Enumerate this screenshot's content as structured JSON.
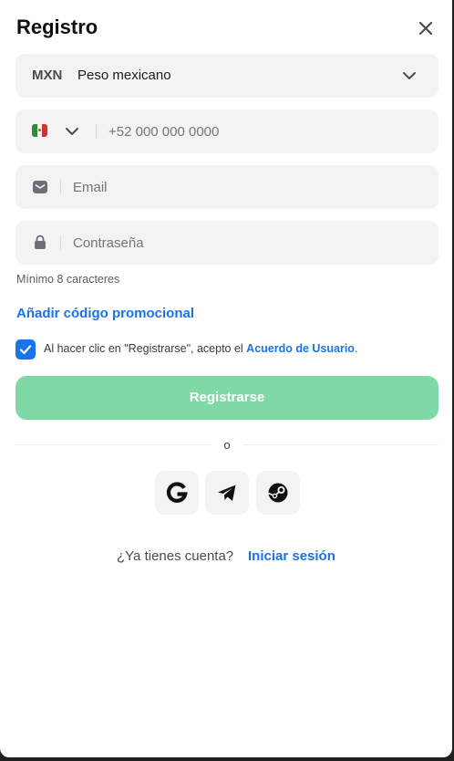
{
  "title": "Registro",
  "currency": {
    "code": "MXN",
    "name": "Peso mexicano"
  },
  "phone": {
    "placeholder": "+52 000 000 0000",
    "flag": "mexico-flag-icon"
  },
  "email": {
    "placeholder": "Email",
    "icon": "mail-icon"
  },
  "password": {
    "placeholder": "Contraseña",
    "icon": "lock-icon",
    "hint": "Mínimo 8 caracteres"
  },
  "promo_link": "Añadir código promocional",
  "terms": {
    "checked": true,
    "text": "Al hacer clic en \"Registrarse\", acepto el ",
    "link": "Acuerdo de Usuario",
    "suffix": "."
  },
  "submit_label": "Registrarse",
  "divider_label": "o",
  "social": [
    "google-icon",
    "telegram-icon",
    "steam-icon"
  ],
  "footer": {
    "question": "¿Ya tienes cuenta?",
    "login_label": "Iniciar sesión"
  },
  "colors": {
    "accent": "#1a73e8",
    "submit_bg": "#7fd9a5",
    "field_bg": "#f3f3f4"
  }
}
